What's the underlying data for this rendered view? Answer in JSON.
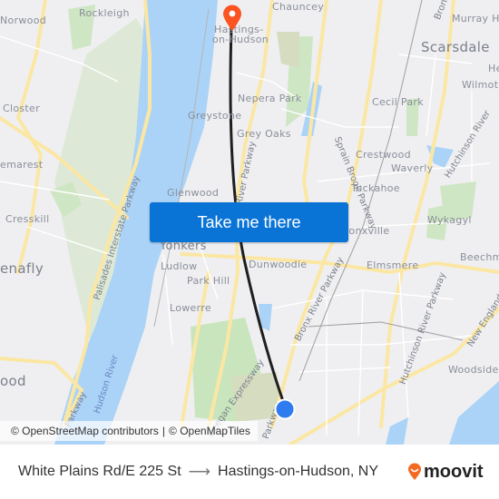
{
  "map": {
    "origin_marker": {
      "label": "White Plains Rd/E 225 St",
      "color": "#2f7cf0"
    },
    "destination_marker": {
      "label": "Hastings-on-Hudson",
      "color": "#fb5420"
    },
    "route_line_color": "#1f1f1f",
    "places": {
      "chauncey": "Chauncey",
      "murray_hill": "Murray Hi",
      "rockleigh": "Rockleigh",
      "norwood": "Norwood",
      "hastings_1": "Hastings-",
      "hastings_2": "on-Hudson",
      "scarsdale": "Scarsdale",
      "he": "He",
      "wilmot": "Wilmot",
      "nepera_park": "Nepera Park",
      "cecil_park": "Cecil Park",
      "closter": "Closter",
      "greystone": "Greystone",
      "grey_oaks": "Grey Oaks",
      "crestwood": "Crestwood",
      "waverly": "Waverly",
      "demarest": "emarest",
      "tuckahoe": "Tuckahoe",
      "glenwood": "Glenwood",
      "cresskill": "Cresskill",
      "wykagyl": "Wykagyl",
      "bronxville": "Bronxville",
      "yonkers": "Yonkers",
      "tenafly": "enafly",
      "dunwoodie": "Dunwoodie",
      "elmsmere": "Elmsmere",
      "beechmont": "Beechm",
      "ludlow": "Ludlow",
      "park_hill": "Park Hill",
      "lowerre": "Lowerre",
      "woodside": "Woodside",
      "englewood": "ood"
    },
    "roads": {
      "bronx": "Bronx",
      "hutchinson_top": "Hutchinson River",
      "sprain": "Sprain Brook Parkway",
      "saw_mill": "River Parkway",
      "palisades": "Palisades Interstate Parkway",
      "bronx_river": "Bronx River Parkway",
      "hutchinson": "Hutchinson River Parkway",
      "new_england": "New England",
      "mosholu": "Parkway",
      "deegan": "Deegan Expressway",
      "hudson_river": "Hudson River",
      "parkway_bottom": "Parkway"
    }
  },
  "cta_button": {
    "label": "Take me there"
  },
  "attribution": {
    "osm": "© OpenStreetMap contributors",
    "separator": "|",
    "omt": "© OpenMapTiles"
  },
  "footer": {
    "origin": "White Plains Rd/E 225 St",
    "arrow": "⟶",
    "destination": "Hastings-on-Hudson, NY",
    "brand": "moovit",
    "brand_color": "#f26a21"
  }
}
